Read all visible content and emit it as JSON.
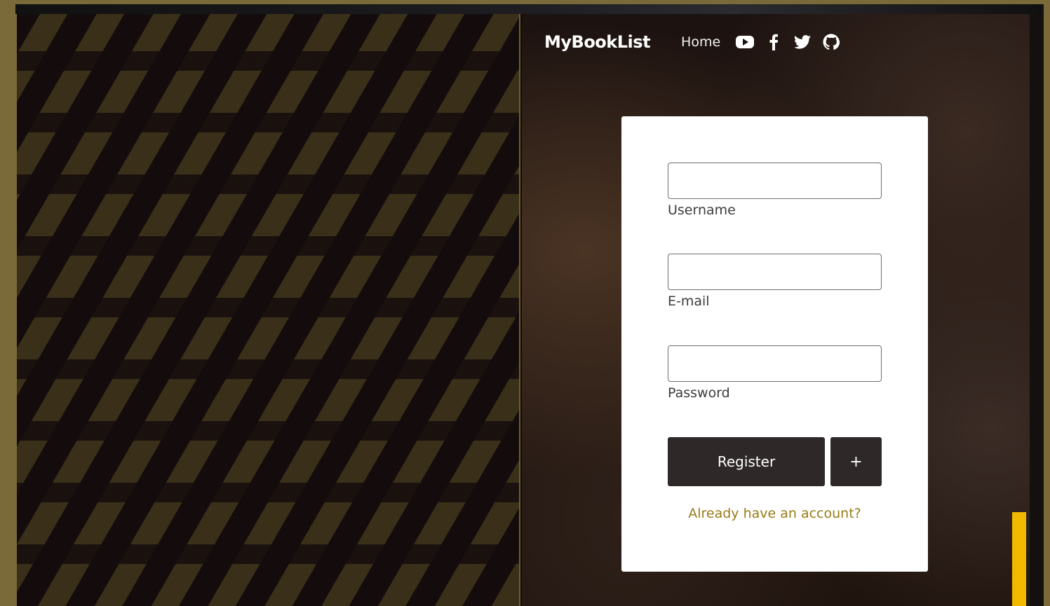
{
  "navbar": {
    "brand": "MyBookList",
    "home": "Home",
    "icons": [
      "youtube-icon",
      "facebook-icon",
      "twitter-icon",
      "github-icon"
    ]
  },
  "form": {
    "username": {
      "label": "Username",
      "value": "",
      "placeholder": ""
    },
    "email": {
      "label": "E-mail",
      "value": "",
      "placeholder": ""
    },
    "password": {
      "label": "Password",
      "value": "",
      "placeholder": ""
    },
    "register_label": "Register",
    "plus_label": "+",
    "login_link": "Already have an account?"
  },
  "colors": {
    "accent_gold": "#9a7a18",
    "button_dark": "#2e2828",
    "yellow_accent": "#f2b800"
  }
}
